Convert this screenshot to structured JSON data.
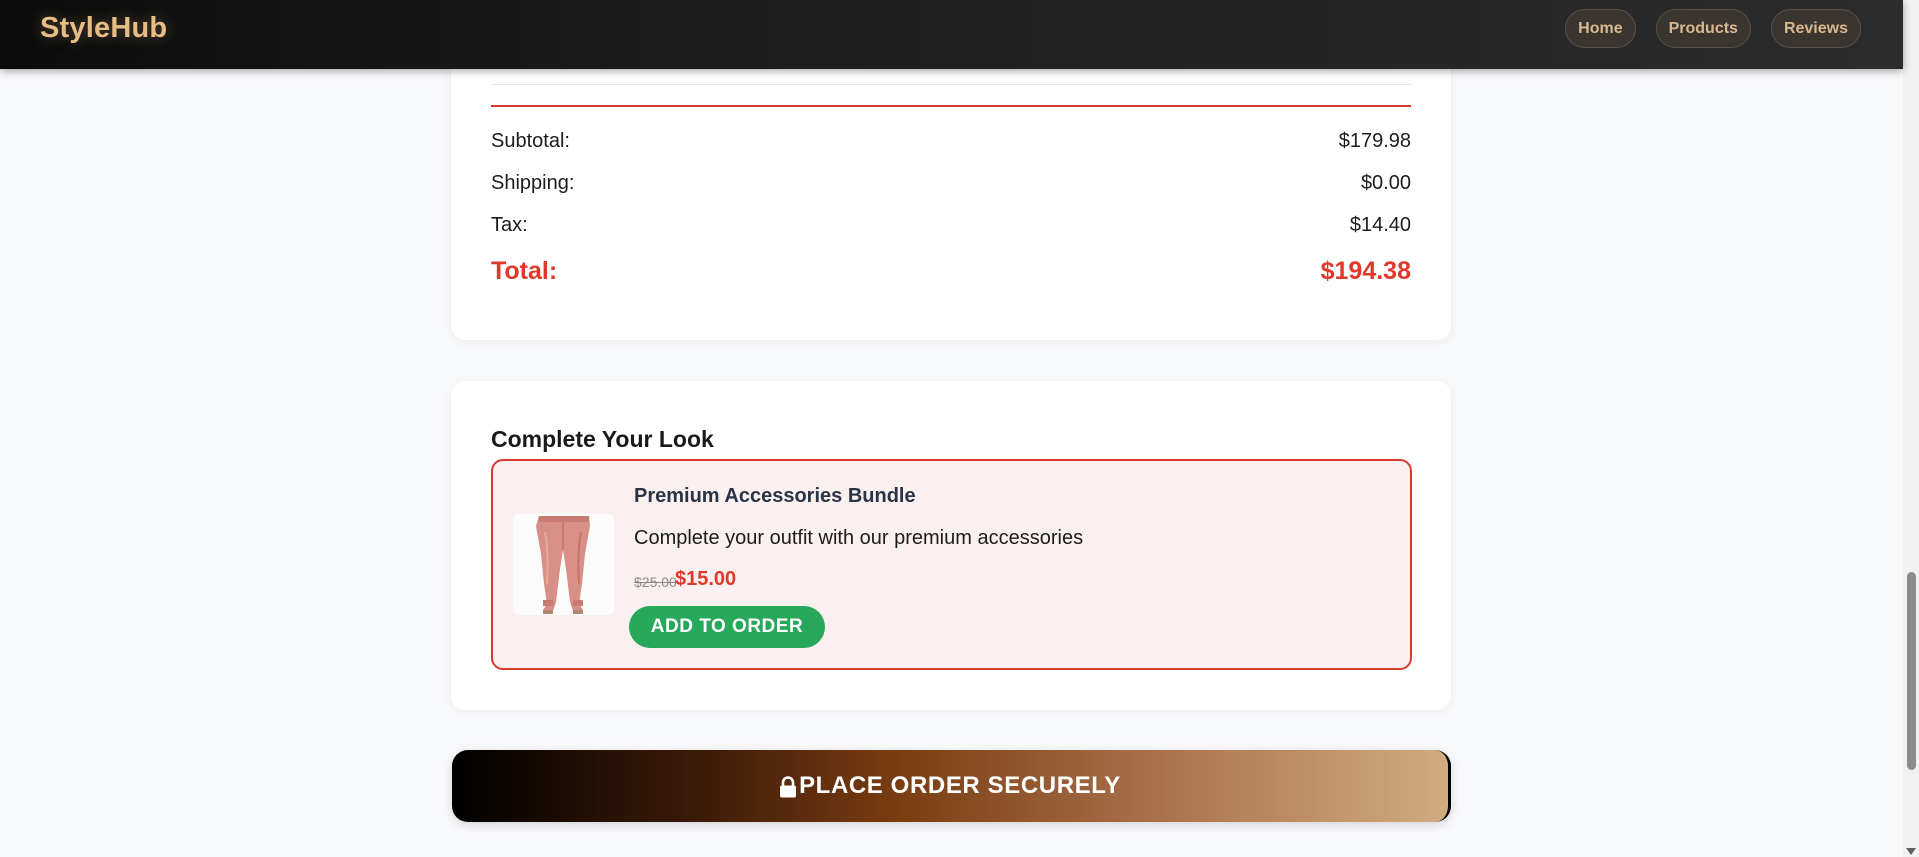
{
  "header": {
    "logo": "StyleHub",
    "nav": [
      "Home",
      "Products",
      "Reviews"
    ]
  },
  "summary": {
    "rows": [
      {
        "label": "Subtotal:",
        "value": "$179.98"
      },
      {
        "label": "Shipping:",
        "value": "$0.00"
      },
      {
        "label": "Tax:",
        "value": "$14.40"
      }
    ],
    "total_label": "Total:",
    "total_value": "$194.38"
  },
  "upsell": {
    "title": "Complete Your Look",
    "name": "Premium Accessories Bundle",
    "description": "Complete your outfit with our premium accessories",
    "old_price": "$25.00",
    "new_price": "$15.00",
    "add_button": "ADD TO ORDER",
    "image_icon": "pink-joggers-image"
  },
  "checkout": {
    "button_label": "PLACE ORDER SECURELY",
    "icon": "lock-icon"
  },
  "colors": {
    "accent_red": "#e0392c",
    "add_green": "#27a85a",
    "logo_gold": "#e6bd84"
  }
}
